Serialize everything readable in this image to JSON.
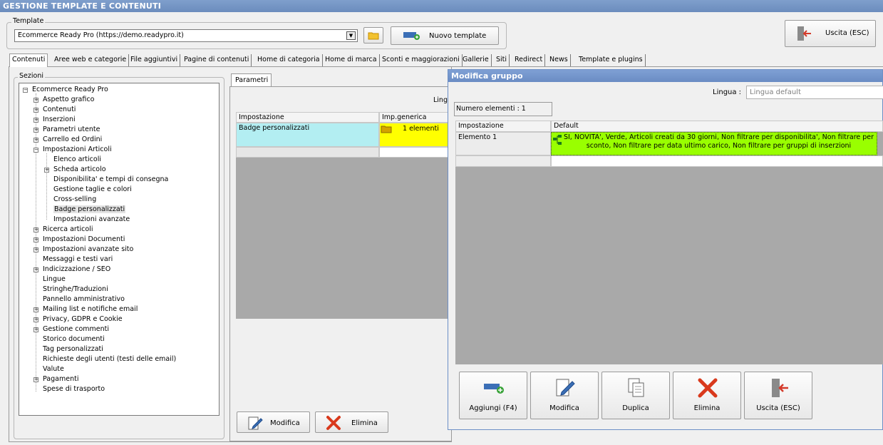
{
  "window": {
    "title": "GESTIONE TEMPLATE E CONTENUTI"
  },
  "template": {
    "group_label": "Template",
    "selected": "Ecommerce Ready Pro (https://demo.readypro.it)",
    "new_button": "Nuovo template",
    "exit_button": "Uscita (ESC)"
  },
  "tabs": [
    "Contenuti",
    "Aree web e categorie",
    "File aggiuntivi",
    "Pagine di contenuti",
    "Home di categoria",
    "Home di marca",
    "Sconti e maggiorazioni",
    "Gallerie",
    "Siti",
    "Redirect",
    "News",
    "Template e plugins"
  ],
  "sections": {
    "label": "Sezioni",
    "root": "Ecommerce Ready Pro",
    "items": [
      "Aspetto grafico",
      "Contenuti",
      "Inserzioni",
      "Parametri utente",
      "Carrello ed Ordini",
      "Impostazioni Articoli",
      "Elenco articoli",
      "Scheda articolo",
      "Disponibilita' e tempi di consegna",
      "Gestione taglie e colori",
      "Cross-selling",
      "Badge personalizzati",
      "Impostazioni avanzate",
      "Ricerca articoli",
      "Impostazioni Documenti",
      "Impostazioni avanzate sito",
      "Messaggi e testi vari",
      "Indicizzazione / SEO",
      "Lingue",
      "Stringhe/Traduzioni",
      "Pannello amministrativo",
      "Mailing list e notifiche email",
      "Privacy, GDPR e Cookie",
      "Gestione commenti",
      "Storico documenti",
      "Tag personalizzati",
      "Richieste degli utenti (testi delle email)",
      "Valute",
      "Pagamenti",
      "Spese di trasporto"
    ]
  },
  "params": {
    "tab": "Parametri",
    "lingua_partial": "Lingu",
    "col_setting": "Impostazione",
    "col_generic": "Imp.generica",
    "row_name": "Badge personalizzati",
    "row_value": "1 elementi",
    "modify_button": "Modifica",
    "delete_button": "Elimina"
  },
  "dialog": {
    "title": "Modifica gruppo",
    "lingua_label": "Lingua :",
    "lingua_placeholder": "Lingua default",
    "count_label": "Numero elementi : 1",
    "col_setting": "Impostazione",
    "col_default": "Default",
    "row_name": "Elemento 1",
    "row_value": "SI, NOVITA', Verde, Articoli creati da 30 giorni, Non filtrare per disponibilita', Non filtrare per sconto, Non filtrare per data ultimo carico, Non filtrare per gruppi di inserzioni",
    "buttons": {
      "add": "Aggiungi (F4)",
      "modify": "Modifica",
      "duplicate": "Duplica",
      "delete": "Elimina",
      "exit": "Uscita (ESC)"
    }
  },
  "colors": {
    "highlight_cyan": "#b3eef2",
    "highlight_yellow": "#ffff00",
    "highlight_green": "#99ff00",
    "grid_gray": "#a9a9a9"
  }
}
